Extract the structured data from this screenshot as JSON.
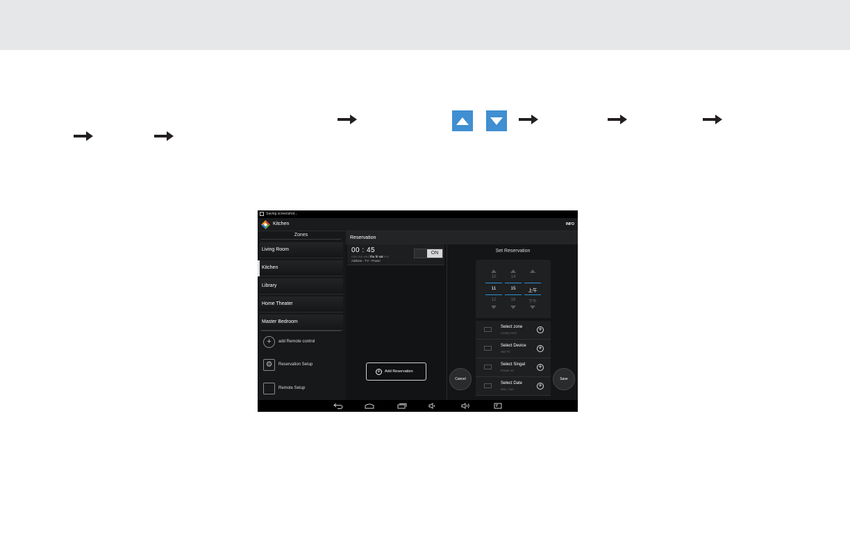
{
  "device": {
    "status_text": "Saving screenshot...",
    "app_title": "Kitchen",
    "info_label": "INFO",
    "zones_header": "Zones",
    "zones": [
      {
        "label": "Living Room",
        "selected": false
      },
      {
        "label": "Kitchen",
        "selected": true
      },
      {
        "label": "Library",
        "selected": false
      },
      {
        "label": "Home Theater",
        "selected": false
      },
      {
        "label": "Master Bedroom",
        "selected": false
      }
    ],
    "menu": [
      {
        "label": "add Remote control",
        "icon": "plus-circle-icon"
      },
      {
        "label": "Reservation Setup",
        "icon": "gear-icon"
      },
      {
        "label": "Remote Setup",
        "icon": "remote-icon"
      }
    ],
    "reservation_header": "Reservation",
    "reservation_item": {
      "time": "00 : 45",
      "days_inactive": [
        "mon",
        "tue",
        "wed"
      ],
      "days_active": [
        "thu",
        "fri",
        "sat"
      ],
      "days_trailing": "sun",
      "description": "Addone - TV - Power",
      "toggle": "ON"
    },
    "add_reservation_label": "Add Reservation",
    "set_reservation_title": "Set Reservation",
    "picker": {
      "hour": [
        "10",
        "11",
        "12"
      ],
      "minute": [
        "14",
        "15",
        "16"
      ],
      "ampm": [
        "",
        "上午",
        "下午"
      ]
    },
    "select_rows": [
      {
        "title": "Select zone",
        "sub": "Living room"
      },
      {
        "title": "Select Device",
        "sub": "SM TV"
      },
      {
        "title": "Select Singal",
        "sub": "Power on"
      },
      {
        "title": "Select Date",
        "sub": "Mon, Tue"
      }
    ],
    "cancel_label": "Cancel",
    "save_label": "Save"
  }
}
